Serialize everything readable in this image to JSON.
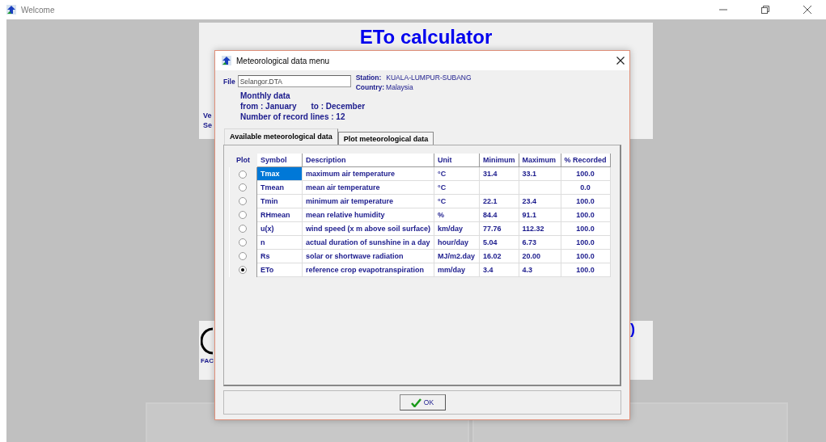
{
  "window": {
    "title": "Welcome"
  },
  "background": {
    "app_title": "ETo calculator",
    "label_1": "Ve",
    "label_2": "Se",
    "logo_caption": "FAC",
    "fragment": ")"
  },
  "dialog": {
    "title": "Meteorological data menu",
    "file": {
      "label": "File",
      "value": "Selangor.DTA"
    },
    "station": {
      "label": "Station:",
      "value": "KUALA-LUMPUR-SUBANG"
    },
    "country": {
      "label": "Country:",
      "value": "Malaysia"
    },
    "period": {
      "heading": "Monthly data",
      "from": "from : January",
      "to": "to : December",
      "records": "Number of record lines : 12"
    },
    "tabs": [
      {
        "label": "Available meteorological data",
        "selected": true
      },
      {
        "label": "Plot meteorological data",
        "selected": false
      }
    ],
    "table": {
      "columns": [
        "Plot",
        "Symbol",
        "Description",
        "Unit",
        "Minimum",
        "Maximum",
        "% Recorded"
      ],
      "rows": [
        {
          "selected": false,
          "highlighted": true,
          "symbol": "Tmax",
          "description": "maximum air temperature",
          "unit": "°C",
          "minimum": "31.4",
          "maximum": "33.1",
          "recorded": "100.0"
        },
        {
          "selected": false,
          "highlighted": false,
          "symbol": "Tmean",
          "description": "mean air temperature",
          "unit": "°C",
          "recorded": "0.0"
        },
        {
          "selected": false,
          "highlighted": false,
          "symbol": "Tmin",
          "description": "minimum air temperature",
          "unit": "°C",
          "minimum": "22.1",
          "maximum": "23.4",
          "recorded": "100.0"
        },
        {
          "selected": false,
          "highlighted": false,
          "symbol": "RHmean",
          "description": "mean relative humidity",
          "unit": "%",
          "minimum": "84.4",
          "maximum": "91.1",
          "recorded": "100.0"
        },
        {
          "selected": false,
          "highlighted": false,
          "symbol": "u(x)",
          "description": "wind speed (x m above soil surface)",
          "unit": "km/day",
          "minimum": "77.76",
          "maximum": "112.32",
          "recorded": "100.0"
        },
        {
          "selected": false,
          "highlighted": false,
          "symbol": "n",
          "description": "actual duration of sunshine in a day",
          "unit": "hour/day",
          "minimum": "5.04",
          "maximum": "6.73",
          "recorded": "100.0"
        },
        {
          "selected": false,
          "highlighted": false,
          "symbol": "Rs",
          "description": "solar or shortwave radiation",
          "unit": "MJ/m2.day",
          "minimum": "16.02",
          "maximum": "20.00",
          "recorded": "100.0"
        },
        {
          "selected": true,
          "highlighted": false,
          "symbol": "ETo",
          "description": "reference crop evapotranspiration",
          "unit": "mm/day",
          "minimum": "3.4",
          "maximum": "4.3",
          "recorded": "100.0"
        }
      ]
    },
    "buttons": [
      {
        "label": "OK"
      }
    ]
  }
}
